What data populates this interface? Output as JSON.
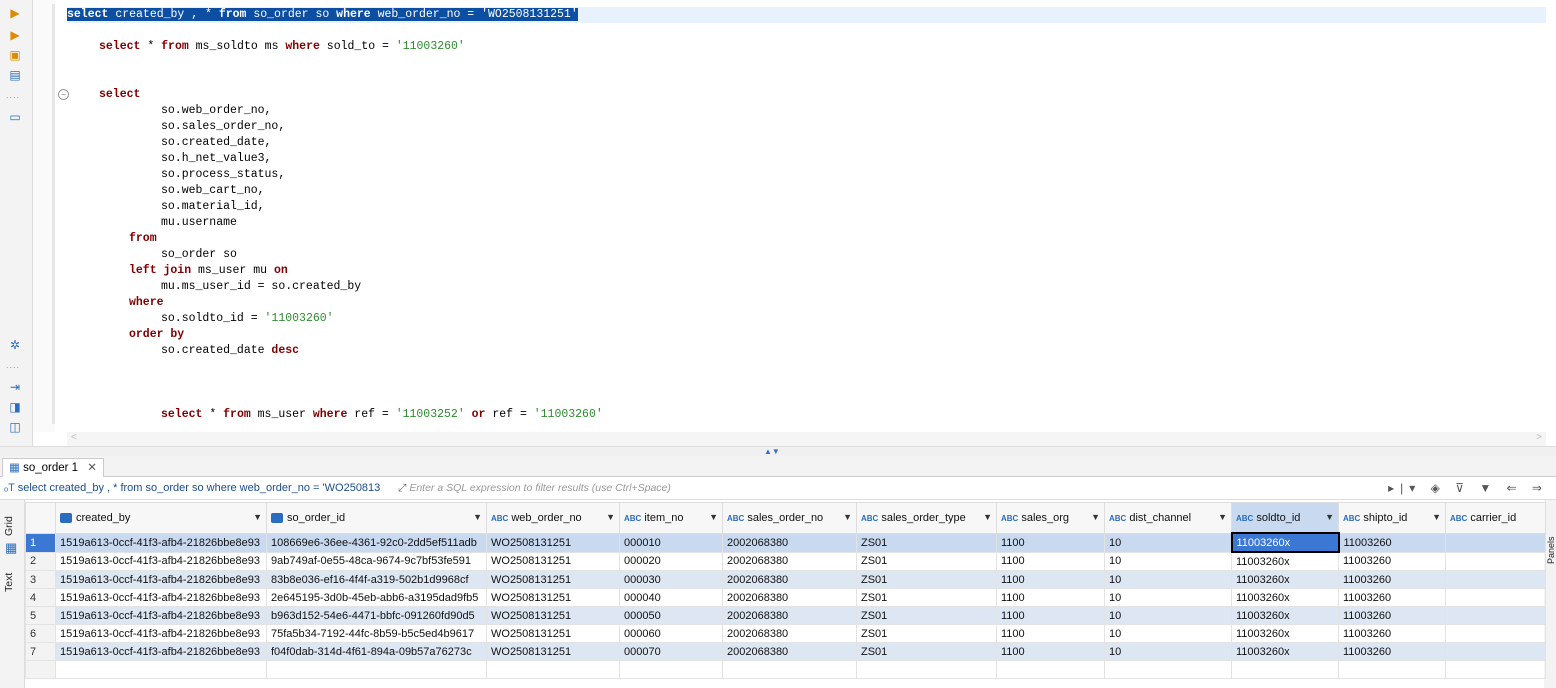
{
  "editor": {
    "lines": [
      "select created_by , * from so_order so where web_order_no = 'WO2508131251'",
      "select * from ms_soldto ms where sold_to = '11003260'",
      "select",
      "so.web_order_no,",
      "so.sales_order_no,",
      "so.created_date,",
      "so.h_net_value3,",
      "so.process_status,",
      "so.web_cart_no,",
      "so.material_id,",
      "mu.username",
      "from",
      "so_order so",
      "left join ms_user mu on",
      "mu.ms_user_id = so.created_by",
      "where",
      "so.soldto_id = '11003260'",
      "order by",
      "so.created_date desc",
      "select * from ms_user where ref = '11003252' or ref = '11003260'"
    ]
  },
  "results": {
    "tab_label": "so_order 1",
    "query_text": "select created_by , * from so_order so where web_order_no = 'WO250813",
    "filter_placeholder": "Enter a SQL expression to filter results (use Ctrl+Space)",
    "side_tabs": [
      "Grid",
      "Text"
    ],
    "right_panel_label": "Panels",
    "columns": [
      "created_by",
      "so_order_id",
      "web_order_no",
      "item_no",
      "sales_order_no",
      "sales_order_type",
      "sales_org",
      "dist_channel",
      "soldto_id",
      "shipto_id",
      "carrier_id"
    ],
    "rows": [
      [
        "1",
        "1519a613-0ccf-41f3-afb4-21826bbe8e93",
        "108669e6-36ee-4361-92c0-2dd5ef511adb",
        "WO2508131251",
        "000010",
        "2002068380",
        "ZS01",
        "1100",
        "10",
        "11003260x",
        "11003260",
        ""
      ],
      [
        "2",
        "1519a613-0ccf-41f3-afb4-21826bbe8e93",
        "9ab749af-0e55-48ca-9674-9c7bf53fe591",
        "WO2508131251",
        "000020",
        "2002068380",
        "ZS01",
        "1100",
        "10",
        "11003260x",
        "11003260",
        ""
      ],
      [
        "3",
        "1519a613-0ccf-41f3-afb4-21826bbe8e93",
        "83b8e036-ef16-4f4f-a319-502b1d9968cf",
        "WO2508131251",
        "000030",
        "2002068380",
        "ZS01",
        "1100",
        "10",
        "11003260x",
        "11003260",
        ""
      ],
      [
        "4",
        "1519a613-0ccf-41f3-afb4-21826bbe8e93",
        "2e645195-3d0b-45eb-abb6-a3195dad9fb5",
        "WO2508131251",
        "000040",
        "2002068380",
        "ZS01",
        "1100",
        "10",
        "11003260x",
        "11003260",
        ""
      ],
      [
        "5",
        "1519a613-0ccf-41f3-afb4-21826bbe8e93",
        "b963d152-54e6-4471-bbfc-091260fd90d5",
        "WO2508131251",
        "000050",
        "2002068380",
        "ZS01",
        "1100",
        "10",
        "11003260x",
        "11003260",
        ""
      ],
      [
        "6",
        "1519a613-0ccf-41f3-afb4-21826bbe8e93",
        "75fa5b34-7192-44fc-8b59-b5c5ed4b9617",
        "WO2508131251",
        "000060",
        "2002068380",
        "ZS01",
        "1100",
        "10",
        "11003260x",
        "11003260",
        ""
      ],
      [
        "7",
        "1519a613-0ccf-41f3-afb4-21826bbe8e93",
        "f04f0dab-314d-4f61-894a-09b57a76273c",
        "WO2508131251",
        "000070",
        "2002068380",
        "ZS01",
        "1100",
        "10",
        "11003260x",
        "11003260",
        ""
      ]
    ]
  },
  "colors": {
    "keyword": "#7f0000",
    "string": "#2e8b2e",
    "selection": "#0b4ea2",
    "accent": "#3b78d4"
  }
}
